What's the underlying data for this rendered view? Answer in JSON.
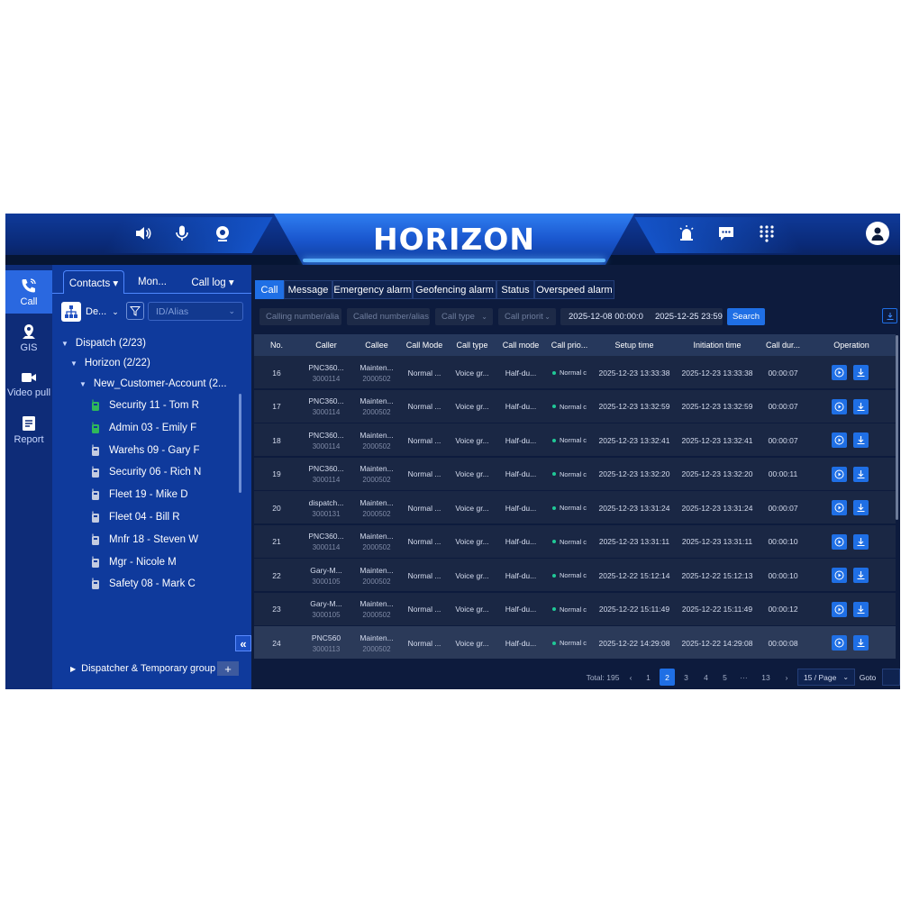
{
  "header": {
    "title": "HORIZON",
    "left_icons": [
      "speaker-icon",
      "microphone-icon",
      "camera-icon"
    ],
    "right_icons": [
      "alarm-icon",
      "message-icon",
      "dialpad-icon",
      "user-icon"
    ]
  },
  "rail": {
    "items": [
      {
        "label": "Call",
        "icon": "phone-icon",
        "active": true
      },
      {
        "label": "GIS",
        "icon": "map-icon",
        "active": false
      },
      {
        "label": "Video pull",
        "icon": "video-icon",
        "active": false
      },
      {
        "label": "Report",
        "icon": "report-icon",
        "active": false
      }
    ]
  },
  "panel": {
    "tabs": [
      {
        "label": "Contacts ▾",
        "active": true
      },
      {
        "label": "Mon...",
        "active": false
      },
      {
        "label": "Call log ▾",
        "active": false
      }
    ],
    "dept_select": "De...",
    "id_placeholder": "ID/Alias",
    "tree": {
      "dispatch": "Dispatch (2/23)",
      "horizon": "Horizon (2/22)",
      "account": "New_Customer-Account (2...",
      "members": [
        {
          "name": "Security 11 - Tom R",
          "device": "green"
        },
        {
          "name": "Admin 03 - Emily F",
          "device": "green"
        },
        {
          "name": "Warehs 09 - Gary F",
          "device": "gray"
        },
        {
          "name": "Security 06 - Rich N",
          "device": "gray"
        },
        {
          "name": "Fleet 19 - Mike D",
          "device": "gray"
        },
        {
          "name": "Fleet 04 - Bill R",
          "device": "gray"
        },
        {
          "name": "Mnfr 18 - Steven W",
          "device": "gray"
        },
        {
          "name": "Mgr - Nicole M",
          "device": "gray"
        },
        {
          "name": "Safety 08 - Mark C",
          "device": "gray"
        }
      ]
    },
    "dispatcher_group": "Dispatcher & Temporary group",
    "plus": "+",
    "collapse": "«"
  },
  "main": {
    "tabs": [
      "Call",
      "Message",
      "Emergency alarm",
      "Geofencing alarm",
      "Status",
      "Overspeed alarm"
    ],
    "active_tab": "Call",
    "filters": {
      "calling_placeholder": "Calling number/alia",
      "called_placeholder": "Called number/alias",
      "call_type_placeholder": "Call type",
      "call_priority_placeholder": "Call priorit",
      "date_start": "2025-12-08 00:00:0",
      "date_end": "2025-12-25 23:59:5",
      "search_label": "Search"
    },
    "table": {
      "headers": [
        "No.",
        "Caller",
        "Callee",
        "Call Mode",
        "Call type",
        "Call mode",
        "Call prio...",
        "Setup time",
        "Initiation time",
        "Call dur...",
        "Operation"
      ],
      "rows": [
        {
          "no": "16",
          "caller": "PNC360...",
          "caller_id": "3000114",
          "callee": "Mainten...",
          "callee_id": "2000502",
          "call_mode": "Normal ...",
          "call_type": "Voice gr...",
          "mode": "Half-du...",
          "priority": "Normal c",
          "setup": "2025-12-23 13:33:38",
          "initiation": "2025-12-23 13:33:38",
          "duration": "00:00:07"
        },
        {
          "no": "17",
          "caller": "PNC360...",
          "caller_id": "3000114",
          "callee": "Mainten...",
          "callee_id": "2000502",
          "call_mode": "Normal ...",
          "call_type": "Voice gr...",
          "mode": "Half-du...",
          "priority": "Normal c",
          "setup": "2025-12-23 13:32:59",
          "initiation": "2025-12-23 13:32:59",
          "duration": "00:00:07"
        },
        {
          "no": "18",
          "caller": "PNC360...",
          "caller_id": "3000114",
          "callee": "Mainten...",
          "callee_id": "2000502",
          "call_mode": "Normal ...",
          "call_type": "Voice gr...",
          "mode": "Half-du...",
          "priority": "Normal c",
          "setup": "2025-12-23 13:32:41",
          "initiation": "2025-12-23 13:32:41",
          "duration": "00:00:07"
        },
        {
          "no": "19",
          "caller": "PNC360...",
          "caller_id": "3000114",
          "callee": "Mainten...",
          "callee_id": "2000502",
          "call_mode": "Normal ...",
          "call_type": "Voice gr...",
          "mode": "Half-du...",
          "priority": "Normal c",
          "setup": "2025-12-23 13:32:20",
          "initiation": "2025-12-23 13:32:20",
          "duration": "00:00:11"
        },
        {
          "no": "20",
          "caller": "dispatch...",
          "caller_id": "3000131",
          "callee": "Mainten...",
          "callee_id": "2000502",
          "call_mode": "Normal ...",
          "call_type": "Voice gr...",
          "mode": "Half-du...",
          "priority": "Normal c",
          "setup": "2025-12-23 13:31:24",
          "initiation": "2025-12-23 13:31:24",
          "duration": "00:00:07"
        },
        {
          "no": "21",
          "caller": "PNC360...",
          "caller_id": "3000114",
          "callee": "Mainten...",
          "callee_id": "2000502",
          "call_mode": "Normal ...",
          "call_type": "Voice gr...",
          "mode": "Half-du...",
          "priority": "Normal c",
          "setup": "2025-12-23 13:31:11",
          "initiation": "2025-12-23 13:31:11",
          "duration": "00:00:10"
        },
        {
          "no": "22",
          "caller": "Gary-M...",
          "caller_id": "3000105",
          "callee": "Mainten...",
          "callee_id": "2000502",
          "call_mode": "Normal ...",
          "call_type": "Voice gr...",
          "mode": "Half-du...",
          "priority": "Normal c",
          "setup": "2025-12-22 15:12:14",
          "initiation": "2025-12-22 15:12:13",
          "duration": "00:00:10"
        },
        {
          "no": "23",
          "caller": "Gary-M...",
          "caller_id": "3000105",
          "callee": "Mainten...",
          "callee_id": "2000502",
          "call_mode": "Normal ...",
          "call_type": "Voice gr...",
          "mode": "Half-du...",
          "priority": "Normal c",
          "setup": "2025-12-22 15:11:49",
          "initiation": "2025-12-22 15:11:49",
          "duration": "00:00:12"
        },
        {
          "no": "24",
          "caller": "PNC560",
          "caller_id": "3000113",
          "callee": "Mainten...",
          "callee_id": "2000502",
          "call_mode": "Normal ...",
          "call_type": "Voice gr...",
          "mode": "Half-du...",
          "priority": "Normal c",
          "setup": "2025-12-22 14:29:08",
          "initiation": "2025-12-22 14:29:08",
          "duration": "00:00:08"
        }
      ]
    },
    "pager": {
      "total": "Total: 195",
      "prev": "‹",
      "pages": [
        "1",
        "2",
        "3",
        "4",
        "5",
        "···",
        "13"
      ],
      "current": "2",
      "next": "›",
      "per_page": "15 / Page",
      "goto": "Goto"
    }
  },
  "colors": {
    "accent": "#1f6fe5",
    "header": "#0f3a99",
    "panel": "#0f3a9c",
    "table_row": "#1a2744",
    "status_green": "#20c997"
  }
}
